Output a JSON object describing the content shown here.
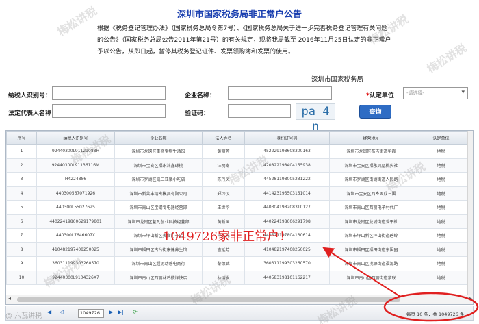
{
  "page": {
    "title": "深圳市国家税务局非正常户公告",
    "notice": "根据《税务登记管理办法》（国家税务总局令第7号）、《国家税务总局关于进一步完善税务登记管理有关问题的公告》（国家税务总局公告2011年第21号）的有关规定，现将我局截至 2016年11月25日认定的非正常户予以公告，从即日起，暂停其税务登记证件、发票领购簿和发票的使用。",
    "org": "深圳市国家税务局"
  },
  "form": {
    "taxpayer_id_label": "纳税人识别号：",
    "company_name_label": "企业名称：",
    "unit_label": "认定单位",
    "unit_required": "*",
    "unit_placeholder": "-请选择-",
    "legal_rep_label": "法定代表人名称：",
    "captcha_label": "验证码：",
    "captcha_text": "pa 4 n",
    "query_button": "查询"
  },
  "table": {
    "columns": [
      "序号",
      "纳税人识别号",
      "企业名称",
      "法人姓名",
      "身份证号码",
      "经营地址",
      "认定单位"
    ],
    "rows": [
      [
        "1",
        "92440300L91121088H",
        "深圳市龙岗区重盛宝物生活馆",
        "黄丽芳",
        "452229198608300163",
        "深圳市龙岗区布吉街道华霞",
        "地税"
      ],
      [
        "2",
        "92440300L91136116M",
        "深圳市宝安区福永鸿鑫球桃",
        "汪明南",
        "420822198404155938",
        "深圳市宝安区福永凤凰桃头社",
        "地税"
      ],
      [
        "3",
        "H4224886",
        "深圳市罗湖区凯三亚聚小吃店",
        "陈丹凤",
        "445281198005231222",
        "深圳市罗湖区南湖街道人民路",
        "地税"
      ],
      [
        "4",
        "440300567071926",
        "深圳市新莱丰精密模具有限公司",
        "郑玲仪",
        "441423195503151014",
        "深圳市宝安区西乡固戍三围",
        "地税"
      ],
      [
        "5",
        "440300L55027625",
        "深圳市南山区宝钢专电器经营部",
        "王世华",
        "440304198208310127",
        "深圳市南山区西丽电子村代广",
        "地税"
      ],
      [
        "6",
        "440224198606291798​01",
        "深圳市龙岗区营凡创业科技经营部",
        "黄新国",
        "440224198606291798",
        "深圳市龙岗区龙城街道爱平社",
        "地税"
      ],
      [
        "7",
        "440300L7646607X",
        "深圳市坪山新区美食门子店",
        "孙桂光",
        "440521197804130614",
        "深圳市坪山新区坪山街道碧岭",
        "地税"
      ],
      [
        "8",
        "410482197408250025",
        "深圳市福田区古台街康健养生馆",
        "吉延芳",
        "410482197408250025",
        "深圳市福田区福田街道东围园",
        "地税"
      ],
      [
        "9",
        "360311199303260570",
        "深圳市南山区超泥动感电商行",
        "黎德武",
        "360311199303260570",
        "深圳市南山区桃源街道福源路",
        "地税"
      ],
      [
        "10",
        "92440300L9104326X7",
        "深圳市南山区西丽林鸡教炸快店",
        "林炳发",
        "440583198101162217",
        "深圳市南山区西丽街道紫联",
        "地税"
      ]
    ]
  },
  "pager": {
    "first": "◀",
    "prev": "◁",
    "page_value": "1049726",
    "next": "▶",
    "last": "▶|",
    "refresh": "⟳",
    "info": "每页 10 条，共 1049726 条"
  },
  "annotation": "1049726家非正常户！",
  "watermark_text": "梅松讲税",
  "footer_watermark": "@ 六瓦讲税"
}
